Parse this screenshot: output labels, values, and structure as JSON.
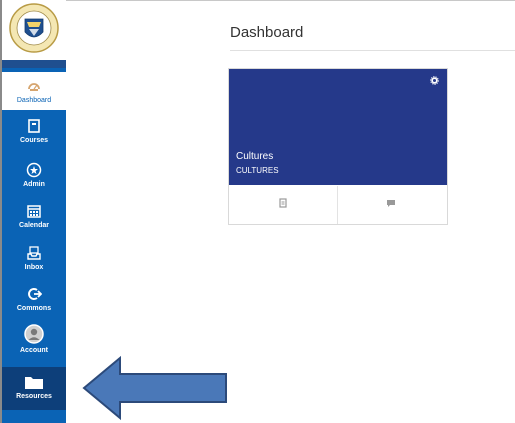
{
  "app": {
    "logo_text": "ST. MARY'S SEMINARY & UNIVERSITY"
  },
  "sidebar": {
    "items": [
      {
        "label": "Dashboard",
        "icon": "dashboard-icon"
      },
      {
        "label": "Courses",
        "icon": "courses-icon"
      },
      {
        "label": "Admin",
        "icon": "admin-shield-icon"
      },
      {
        "label": "Calendar",
        "icon": "calendar-icon"
      },
      {
        "label": "Inbox",
        "icon": "inbox-icon"
      },
      {
        "label": "Commons",
        "icon": "commons-icon"
      },
      {
        "label": "Account",
        "icon": "account-icon"
      },
      {
        "label": "Resources",
        "icon": "folder-icon"
      }
    ]
  },
  "main": {
    "title": "Dashboard",
    "cards": [
      {
        "title": "Cultures",
        "code": "CULTURES",
        "color": "#25398a"
      }
    ]
  },
  "colors": {
    "sidebar": "#0a63b5",
    "sidebar_highlight": "#0d3f7a",
    "card_hero": "#25398a",
    "arrow_fill": "#4a78b8",
    "arrow_stroke": "#2c4a7a"
  }
}
